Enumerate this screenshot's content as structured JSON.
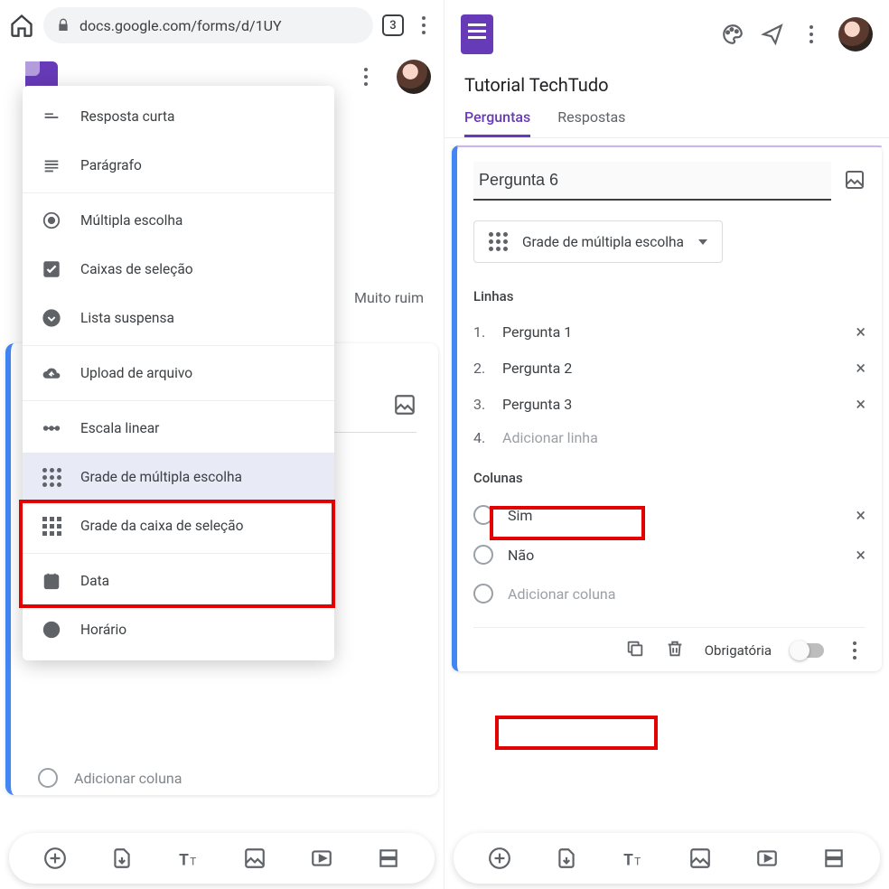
{
  "left": {
    "url": "docs.google.com/forms/d/1UY",
    "tab_count": "3",
    "bg_text": "Muito ruim",
    "add_col_placeholder": "Adicionar coluna",
    "menu": {
      "short_answer": "Resposta curta",
      "paragraph": "Parágrafo",
      "multiple_choice": "Múltipla escolha",
      "checkboxes": "Caixas de seleção",
      "dropdown": "Lista suspensa",
      "file_upload": "Upload de arquivo",
      "linear_scale": "Escala linear",
      "mc_grid": "Grade de múltipla escolha",
      "cb_grid": "Grade da caixa de seleção",
      "date": "Data",
      "time": "Horário"
    }
  },
  "right": {
    "title": "Tutorial TechTudo",
    "tab_questions": "Perguntas",
    "tab_responses": "Respostas",
    "question_title": "Pergunta 6",
    "type_label": "Grade de múltipla escolha",
    "rows_header": "Linhas",
    "rows": [
      "Pergunta 1",
      "Pergunta 2",
      "Pergunta 3"
    ],
    "add_row_placeholder": "Adicionar linha",
    "cols_header": "Colunas",
    "cols": [
      "Sim",
      "Não"
    ],
    "add_col_placeholder": "Adicionar coluna",
    "required_label": "Obrigatória"
  }
}
